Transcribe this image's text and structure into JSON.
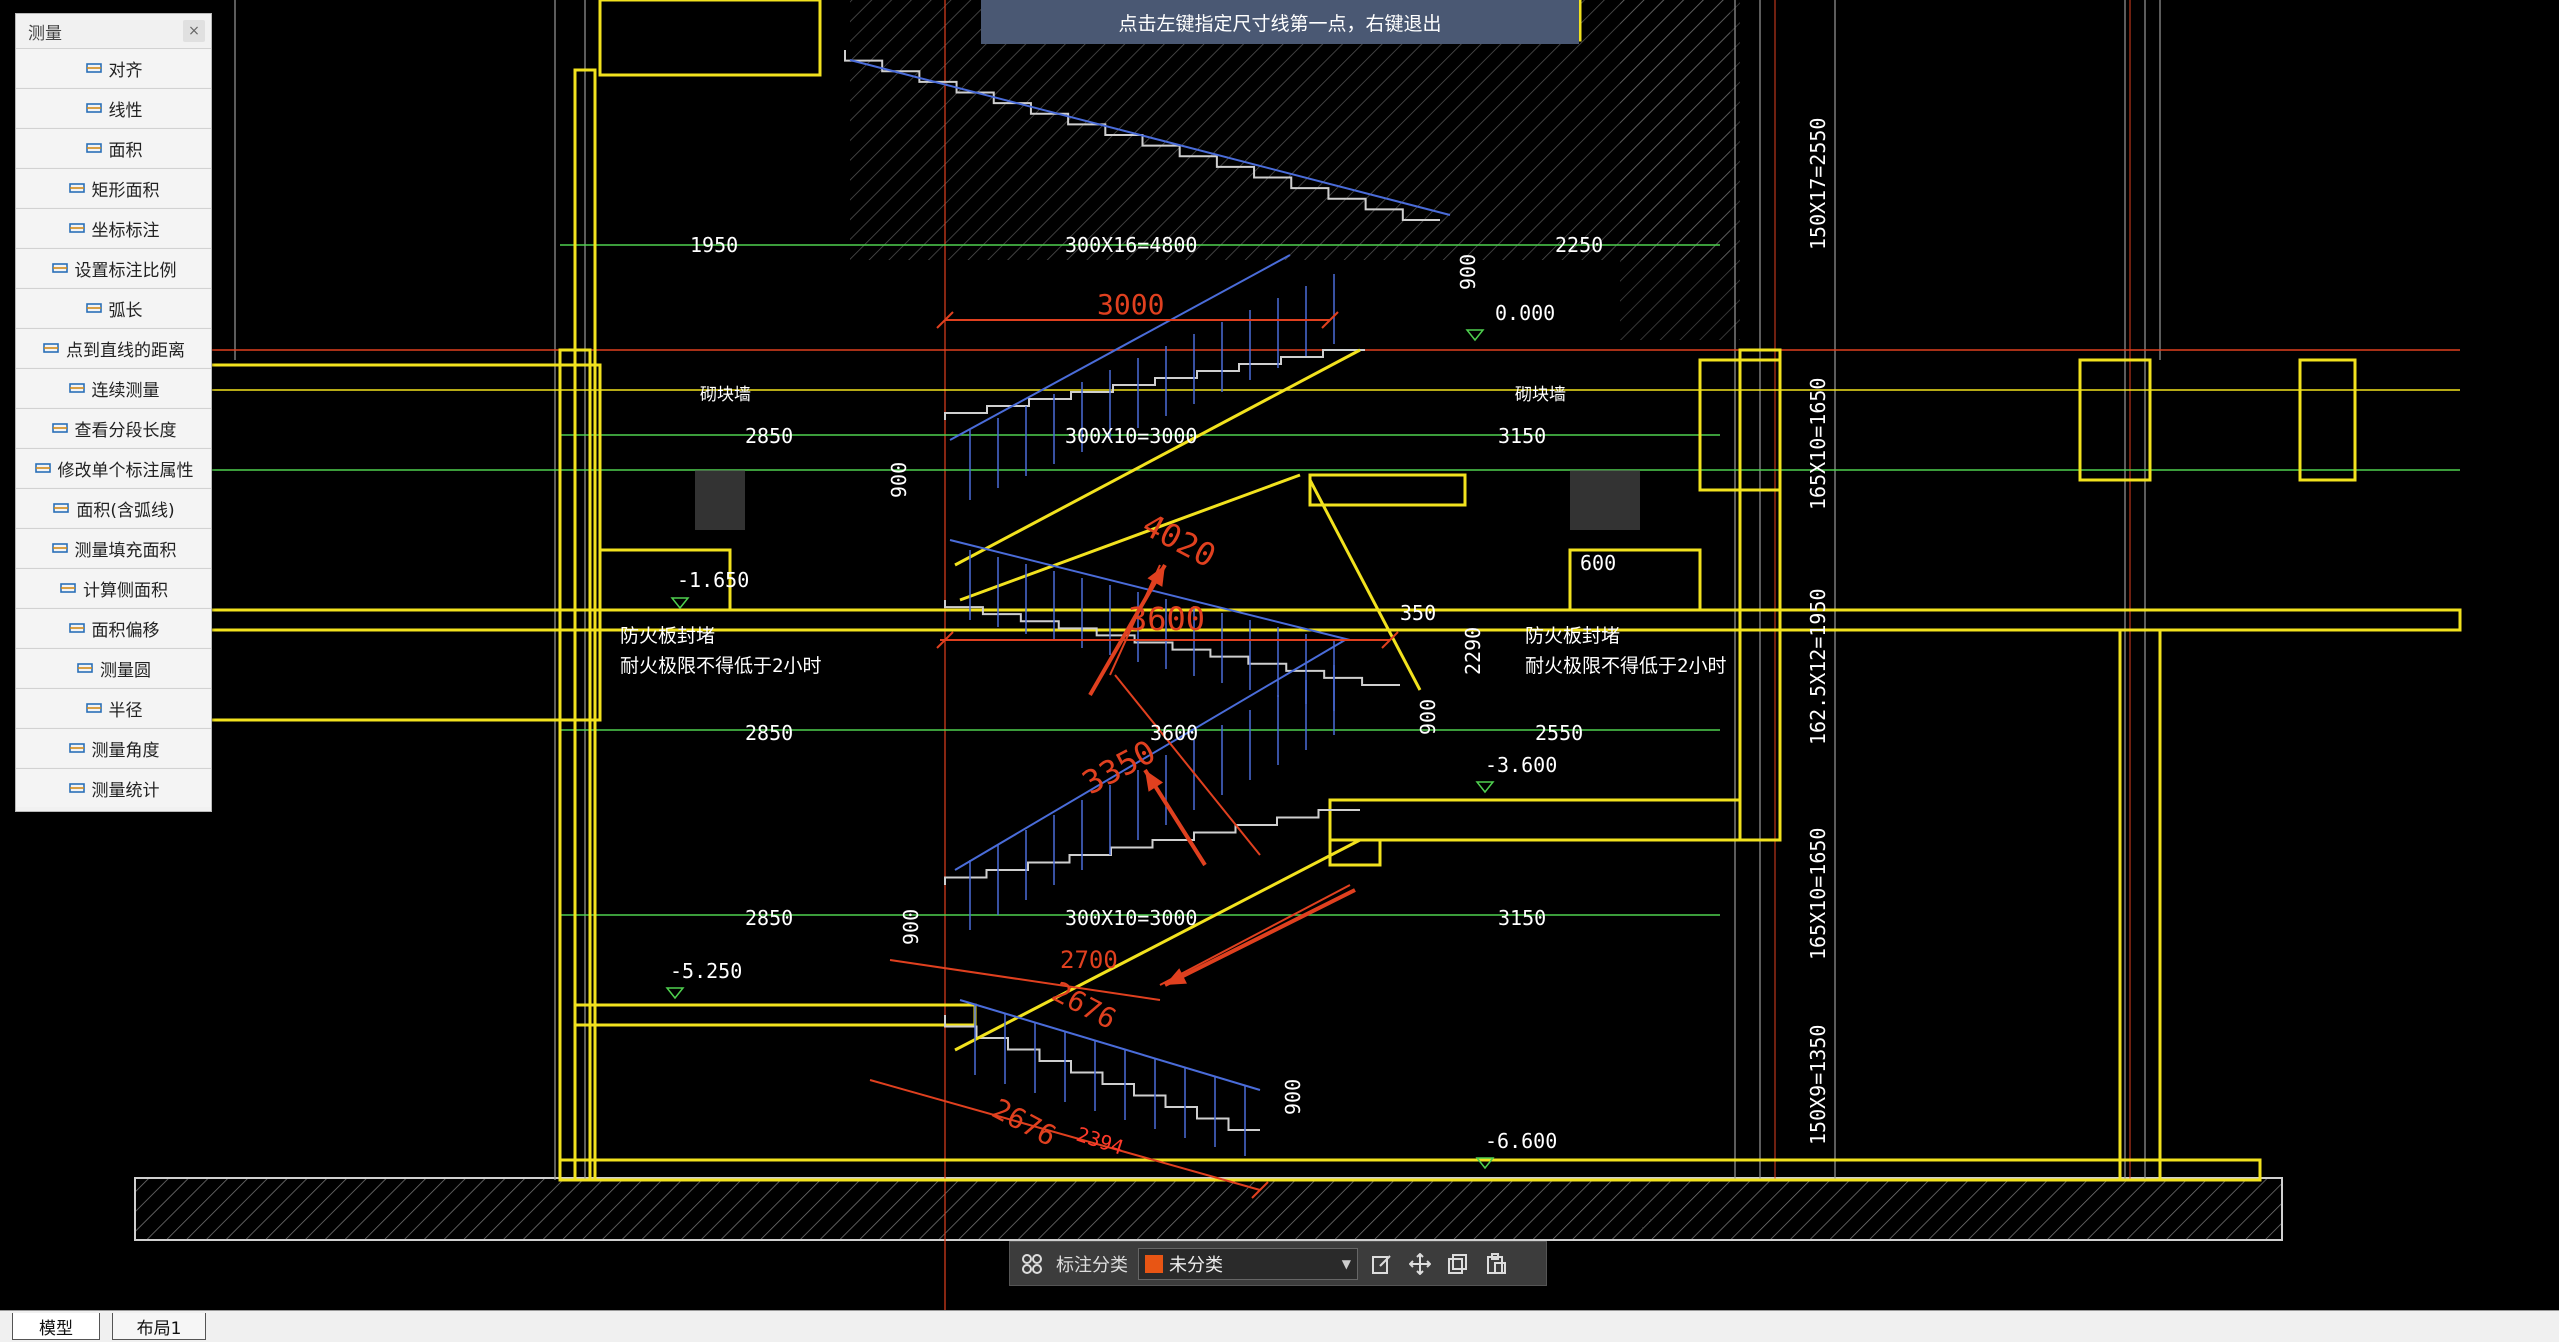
{
  "prompt": "点击左键指定尺寸线第一点，右键退出",
  "panel": {
    "title": "测量",
    "close": "×",
    "tools": [
      {
        "label": "对齐",
        "icon": "align-measure-icon"
      },
      {
        "label": "线性",
        "icon": "linear-measure-icon"
      },
      {
        "label": "面积",
        "icon": "area-icon"
      },
      {
        "label": "矩形面积",
        "icon": "rect-area-icon"
      },
      {
        "label": "坐标标注",
        "icon": "coordinate-icon"
      },
      {
        "label": "设置标注比例",
        "icon": "scale-icon"
      },
      {
        "label": "弧长",
        "icon": "arc-length-icon"
      },
      {
        "label": "点到直线的距离",
        "icon": "point-line-distance-icon"
      },
      {
        "label": "连续测量",
        "icon": "continuous-measure-icon"
      },
      {
        "label": "查看分段长度",
        "icon": "segment-length-icon"
      },
      {
        "label": "修改单个标注属性",
        "icon": "edit-dimension-icon"
      },
      {
        "label": "面积(含弧线)",
        "icon": "arc-area-icon"
      },
      {
        "label": "测量填充面积",
        "icon": "hatch-area-icon"
      },
      {
        "label": "计算侧面积",
        "icon": "side-area-icon"
      },
      {
        "label": "面积偏移",
        "icon": "area-offset-icon"
      },
      {
        "label": "测量圆",
        "icon": "circle-measure-icon"
      },
      {
        "label": "半径",
        "icon": "radius-icon"
      },
      {
        "label": "测量角度",
        "icon": "angle-icon"
      },
      {
        "label": "测量统计",
        "icon": "statistics-icon"
      }
    ]
  },
  "toolbar": {
    "label": "标注分类",
    "category": "未分类",
    "category_color": "#e85514"
  },
  "tabs": [
    "模型",
    "布局1"
  ],
  "drawing": {
    "dims_green": [
      {
        "t": "1950"
      },
      {
        "t": "300X16=4800"
      },
      {
        "t": "2250"
      },
      {
        "t": "900"
      },
      {
        "t": "2850"
      },
      {
        "t": "300X10=3000"
      },
      {
        "t": "3150"
      },
      {
        "t": "900"
      },
      {
        "t": "600"
      },
      {
        "t": "350"
      },
      {
        "t": "2290"
      },
      {
        "t": "2850"
      },
      {
        "t": "3600"
      },
      {
        "t": "2550"
      },
      {
        "t": "900"
      },
      {
        "t": "2850"
      },
      {
        "t": "300X10=3000"
      },
      {
        "t": "3150"
      },
      {
        "t": "900"
      },
      {
        "t": "900"
      },
      {
        "t": "2394"
      }
    ],
    "levels": [
      "0.000",
      "-1.650",
      "-3.600",
      "-5.250",
      "-6.600"
    ],
    "vertical_dims": [
      "150X17=2550",
      "165X10=1650",
      "162.5X12=1950",
      "165X10=1650",
      "150X9=1350"
    ],
    "notes": [
      "砌块墙",
      "砌块墙",
      "防火板封堵",
      "耐火极限不得低于2小时",
      "防火板封堵",
      "耐火极限不得低于2小时"
    ],
    "red_dims": [
      "3000",
      "4020",
      "3600",
      "3350",
      "2700",
      "2676",
      "2676"
    ]
  }
}
